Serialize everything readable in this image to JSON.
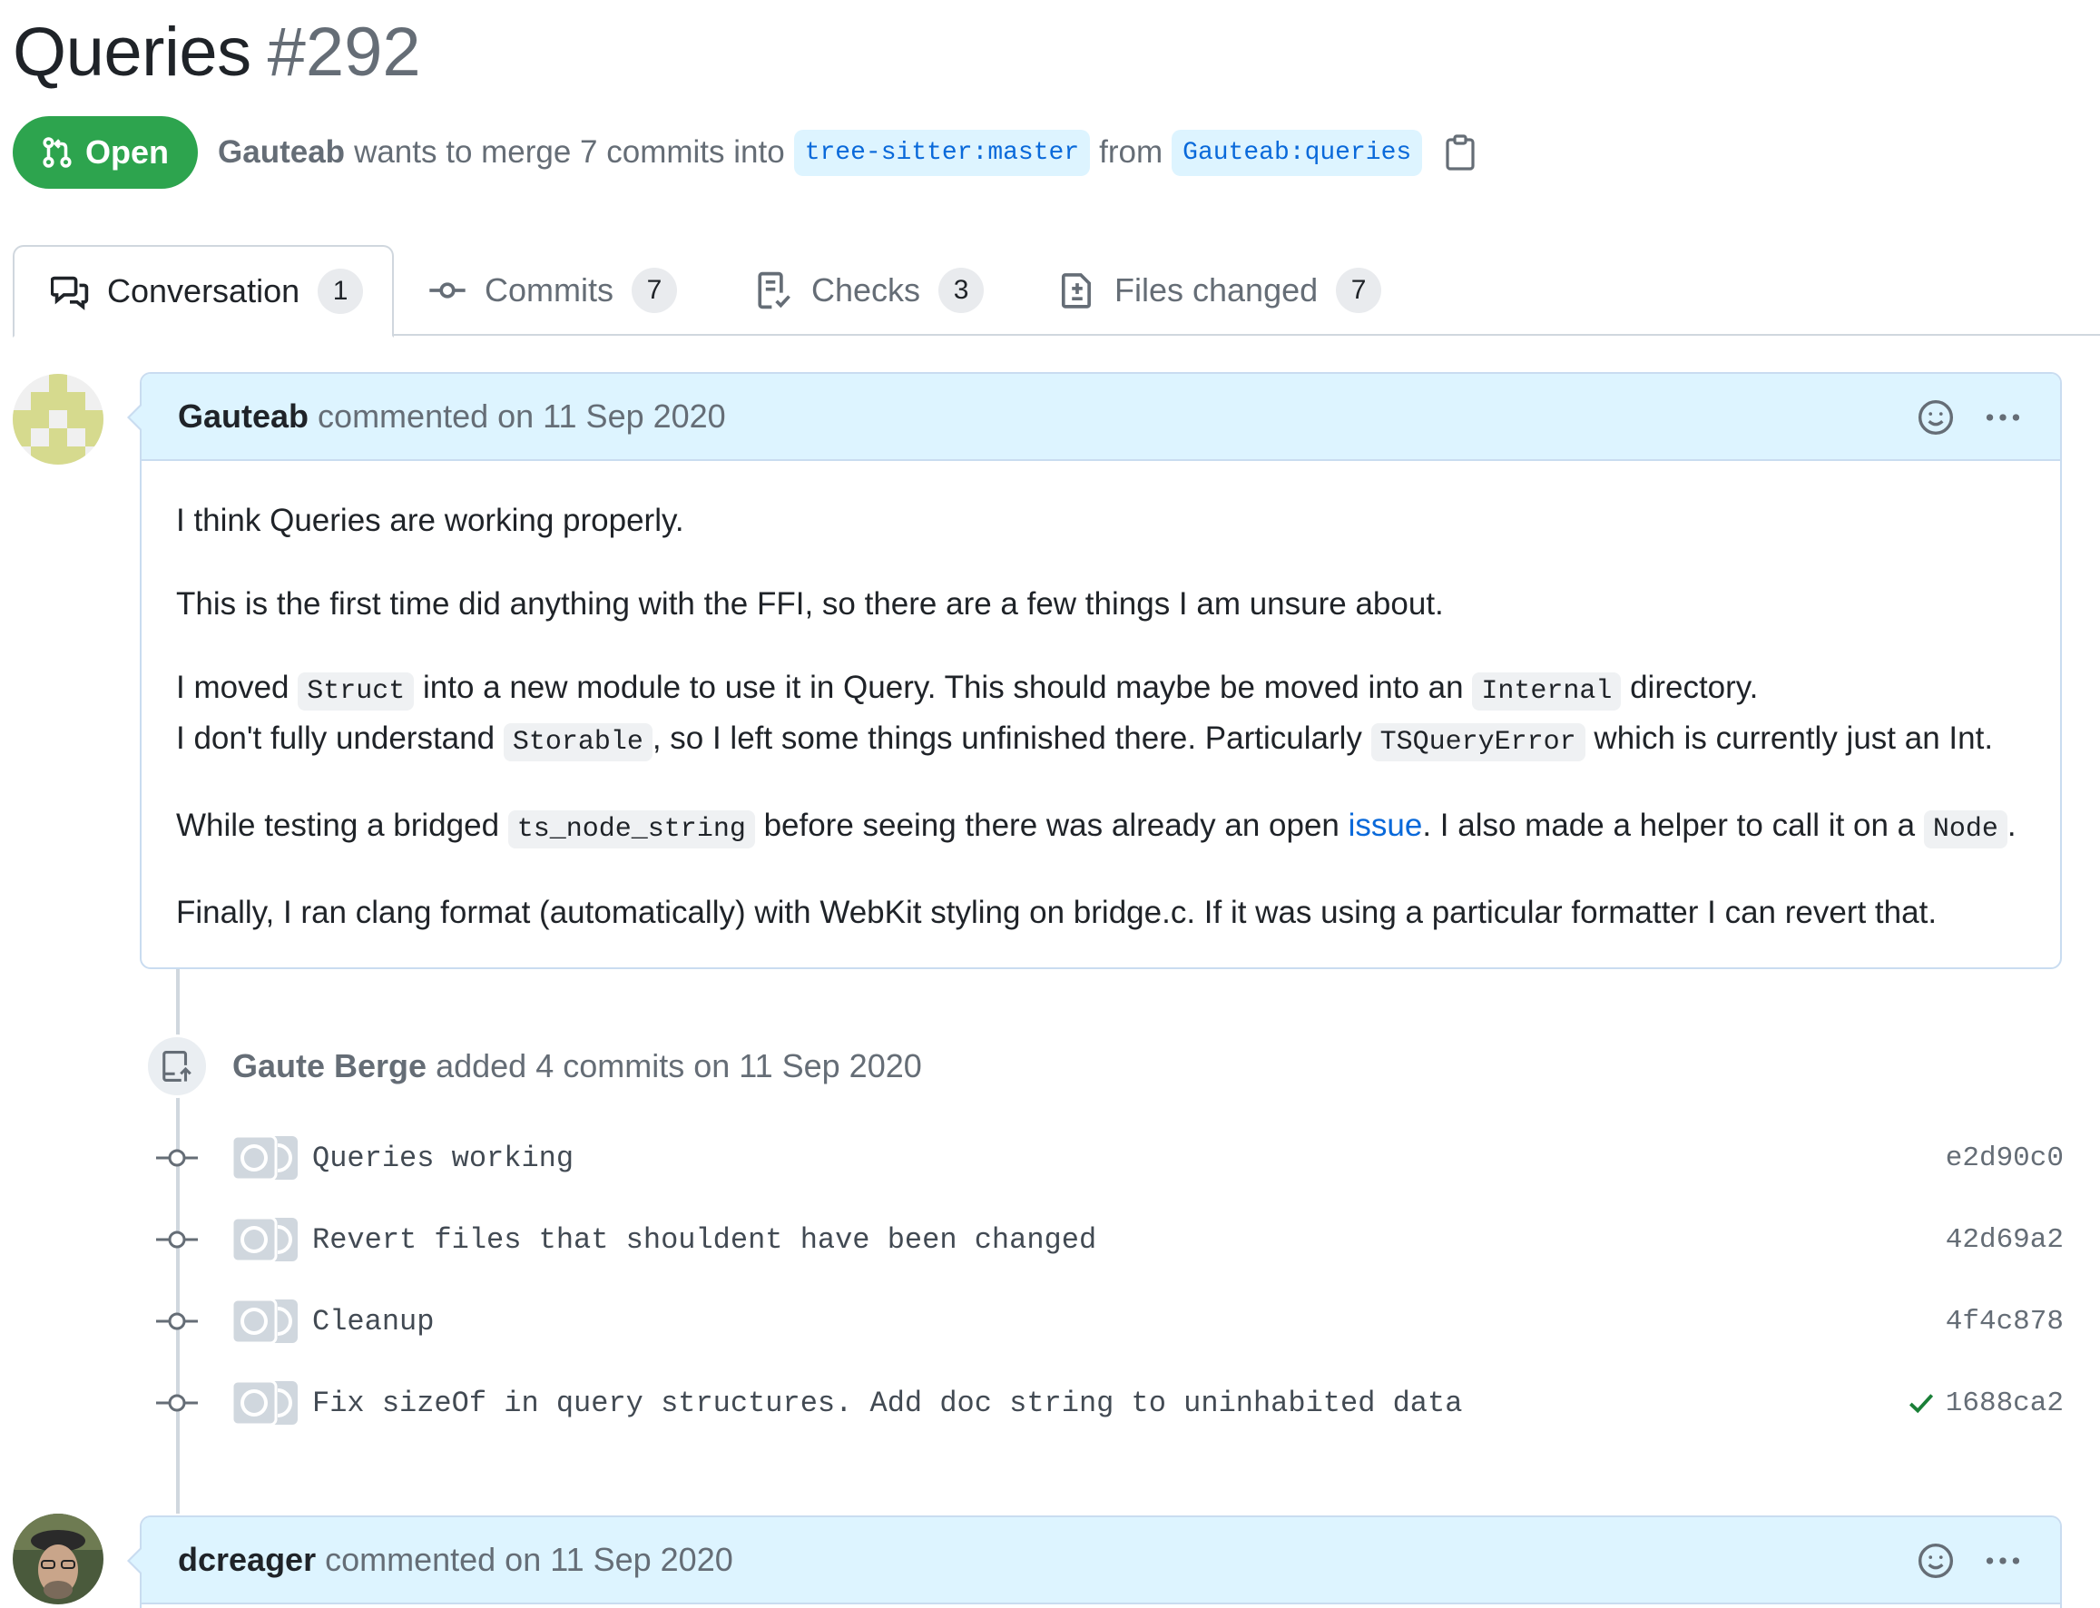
{
  "header": {
    "title": "Queries",
    "number": "#292",
    "state_label": "Open",
    "author": "Gauteab",
    "merge_text": "wants to merge 7 commits into",
    "base_branch": "tree-sitter:master",
    "from_text": "from",
    "head_branch": "Gauteab:queries"
  },
  "tabs": [
    {
      "label": "Conversation",
      "count": "1",
      "icon": "comment-discussion-icon",
      "active": true
    },
    {
      "label": "Commits",
      "count": "7",
      "icon": "git-commit-icon",
      "active": false
    },
    {
      "label": "Checks",
      "count": "3",
      "icon": "checklist-icon",
      "active": false
    },
    {
      "label": "Files changed",
      "count": "7",
      "icon": "file-diff-icon",
      "active": false
    }
  ],
  "comment1": {
    "author": "Gauteab",
    "meta": "commented on 11 Sep 2020",
    "p1": "I think Queries are working properly.",
    "p2": "This is the first time did anything with the FFI, so there are a few things I am unsure about.",
    "p3a": "I moved",
    "p3_code1": "Struct",
    "p3b": "into a new module to use it in Query. This should maybe be moved into an",
    "p3_code2": "Internal",
    "p3c": "directory.",
    "p3d": "I don't fully understand",
    "p3_code3": "Storable",
    "p3e": ", so I left some things unfinished there. Particularly",
    "p3_code4": "TSQueryError",
    "p3f": "which is currently just an Int.",
    "p4a": "While testing a bridged",
    "p4_code1": "ts_node_string",
    "p4b": "before seeing there was already an open",
    "p4_link": "issue",
    "p4c": ". I also made a helper to call it on a",
    "p4_code2": "Node",
    "p4d": ".",
    "p5": "Finally, I ran clang format (automatically) with WebKit styling on bridge.c. If it was using a particular formatter I can revert that."
  },
  "event": {
    "author": "Gaute Berge",
    "text": "added 4 commits on 11 Sep 2020"
  },
  "commits": [
    {
      "message": "Queries working",
      "sha": "e2d90c0",
      "checked": false
    },
    {
      "message": "Revert files that shouldent have been changed",
      "sha": "42d69a2",
      "checked": false
    },
    {
      "message": "Cleanup",
      "sha": "4f4c878",
      "checked": false
    },
    {
      "message": "Fix sizeOf in query structures. Add doc string to uninhabited data",
      "sha": "1688ca2",
      "checked": true
    }
  ],
  "comment2": {
    "author": "dcreager",
    "meta": "commented on 11 Sep 2020"
  },
  "colors": {
    "open_green": "#2da44e",
    "link_blue": "#0969da",
    "comment_header_bg": "#ddf4ff"
  }
}
